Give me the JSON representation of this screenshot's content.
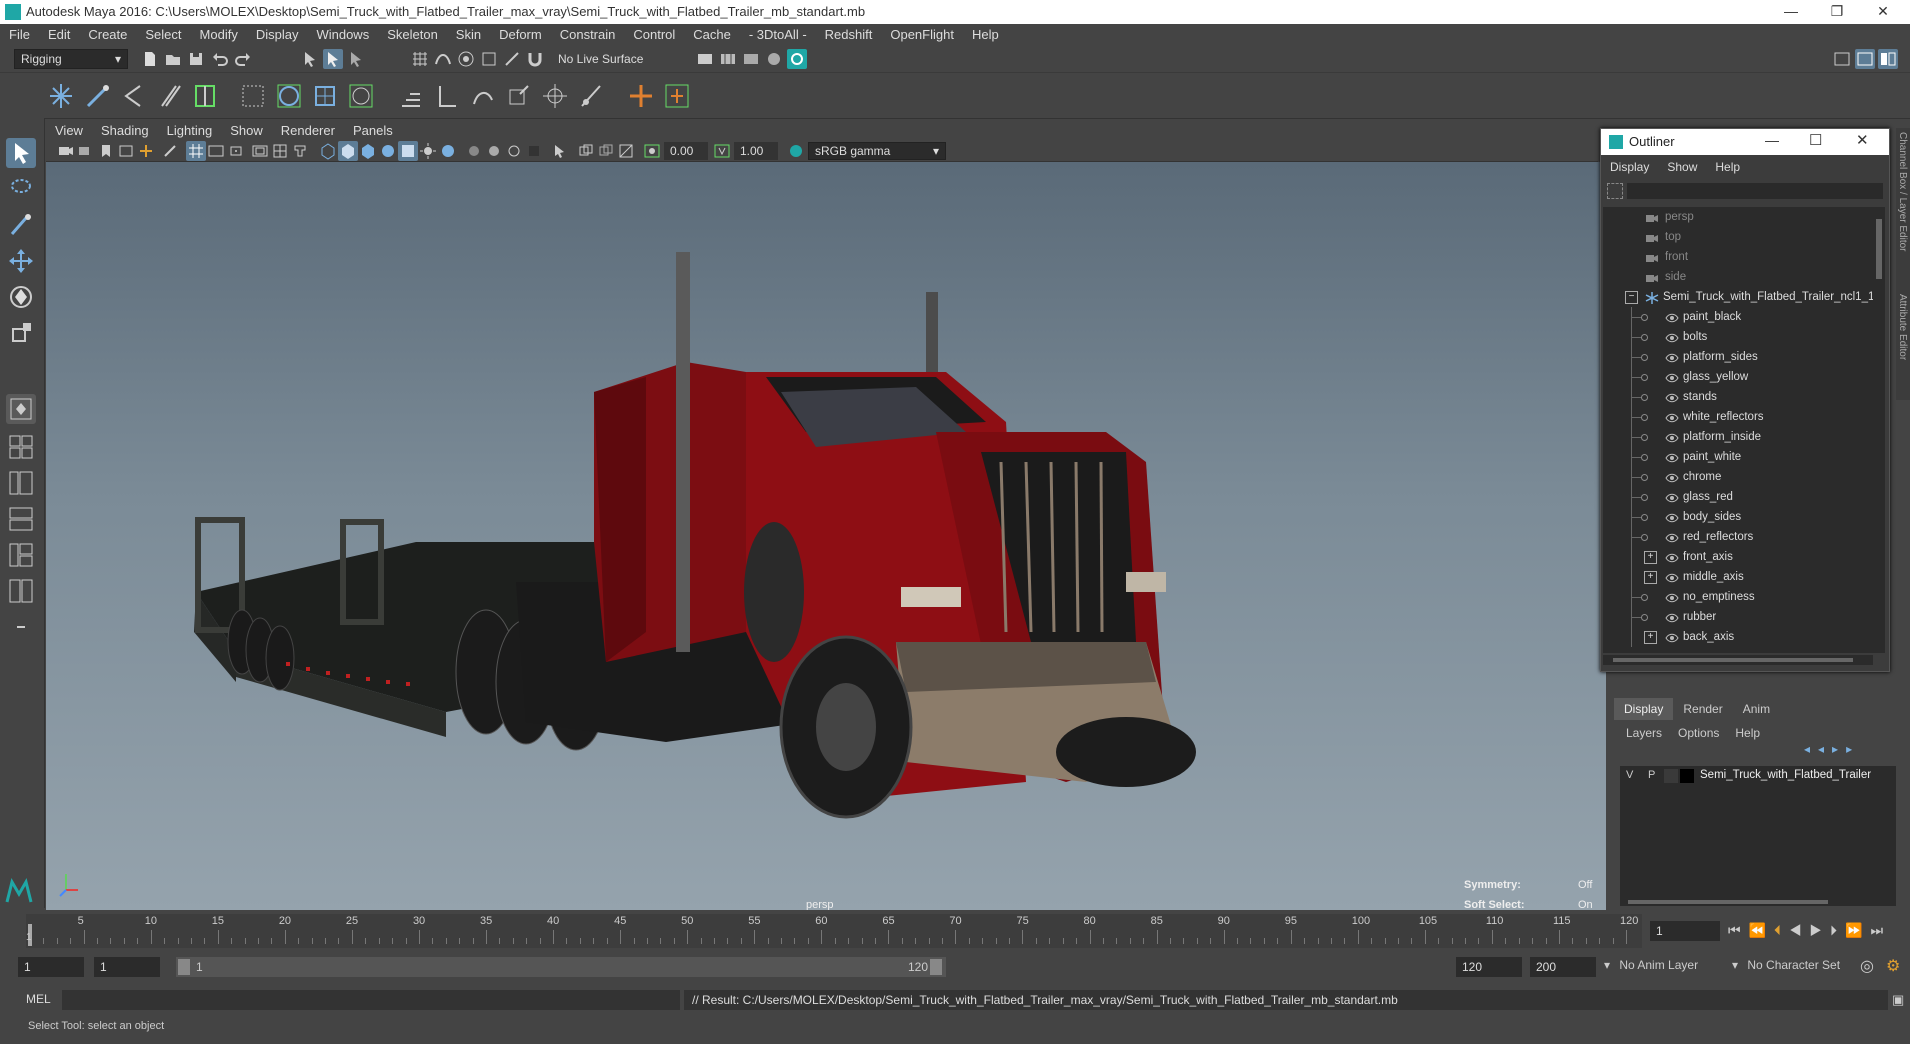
{
  "window": {
    "title": "Autodesk Maya 2016: C:\\Users\\MOLEX\\Desktop\\Semi_Truck_with_Flatbed_Trailer_max_vray\\Semi_Truck_with_Flatbed_Trailer_mb_standart.mb",
    "minimize": "—",
    "restore": "❐",
    "close": "✕"
  },
  "menubar": [
    "File",
    "Edit",
    "Create",
    "Select",
    "Modify",
    "Display",
    "Windows",
    "Skeleton",
    "Skin",
    "Deform",
    "Constrain",
    "Control",
    "Cache",
    "- 3DtoAll -",
    "Redshift",
    "OpenFlight",
    "Help"
  ],
  "shelf": {
    "mode": "Rigging",
    "live_surface": "No Live Surface"
  },
  "panel_menu": [
    "View",
    "Shading",
    "Lighting",
    "Show",
    "Renderer",
    "Panels"
  ],
  "panel_toolbar": {
    "exposure": "0.00",
    "gamma": "1.00",
    "color_space": "sRGB gamma"
  },
  "viewport": {
    "camera": "persp",
    "symmetry_label": "Symmetry:",
    "symmetry_value": "Off",
    "soft_select_label": "Soft Select:",
    "soft_select_value": "On"
  },
  "outliner": {
    "title": "Outliner",
    "menu": [
      "Display",
      "Show",
      "Help"
    ],
    "cameras": [
      "persp",
      "top",
      "front",
      "side"
    ],
    "root": "Semi_Truck_with_Flatbed_Trailer_ncl1_1",
    "children": [
      {
        "label": "paint_black",
        "expandable": false
      },
      {
        "label": "bolts",
        "expandable": false
      },
      {
        "label": "platform_sides",
        "expandable": false
      },
      {
        "label": "glass_yellow",
        "expandable": false
      },
      {
        "label": "stands",
        "expandable": false
      },
      {
        "label": "white_reflectors",
        "expandable": false
      },
      {
        "label": "platform_inside",
        "expandable": false
      },
      {
        "label": "paint_white",
        "expandable": false
      },
      {
        "label": "chrome",
        "expandable": false
      },
      {
        "label": "glass_red",
        "expandable": false
      },
      {
        "label": "body_sides",
        "expandable": false
      },
      {
        "label": "red_reflectors",
        "expandable": false
      },
      {
        "label": "front_axis",
        "expandable": true
      },
      {
        "label": "middle_axis",
        "expandable": true
      },
      {
        "label": "no_emptiness",
        "expandable": false
      },
      {
        "label": "rubber",
        "expandable": false
      },
      {
        "label": "back_axis",
        "expandable": true
      }
    ]
  },
  "side_tabs": [
    "Channel Box / Layer Editor",
    "Attribute Editor"
  ],
  "layer_editor": {
    "tabs": [
      "Display",
      "Render",
      "Anim"
    ],
    "menu": [
      "Layers",
      "Options",
      "Help"
    ],
    "layer": {
      "v": "V",
      "p": "P",
      "name": "Semi_Truck_with_Flatbed_Trailer"
    }
  },
  "timeline": {
    "ticks": [
      "5",
      "10",
      "15",
      "20",
      "25",
      "30",
      "35",
      "40",
      "45",
      "50",
      "55",
      "60",
      "65",
      "70",
      "75",
      "80",
      "85",
      "90",
      "95",
      "100",
      "105",
      "110",
      "115",
      "120"
    ],
    "current_marker": "1",
    "current_frame": "1"
  },
  "range": {
    "start": "1",
    "playback_start": "1",
    "slider_start": "1",
    "slider_end": "120",
    "playback_end": "120",
    "end": "200",
    "anim_layer": "No Anim Layer",
    "character_set": "No Character Set"
  },
  "command": {
    "lang": "MEL",
    "result": "// Result: C:/Users/MOLEX/Desktop/Semi_Truck_with_Flatbed_Trailer_max_vray/Semi_Truck_with_Flatbed_Trailer_mb_standart.mb"
  },
  "help_line": "Select Tool: select an object",
  "colors": {
    "ui_bg": "#444444",
    "accent": "#1fa7a6",
    "truck_red": "#8e0e14"
  }
}
